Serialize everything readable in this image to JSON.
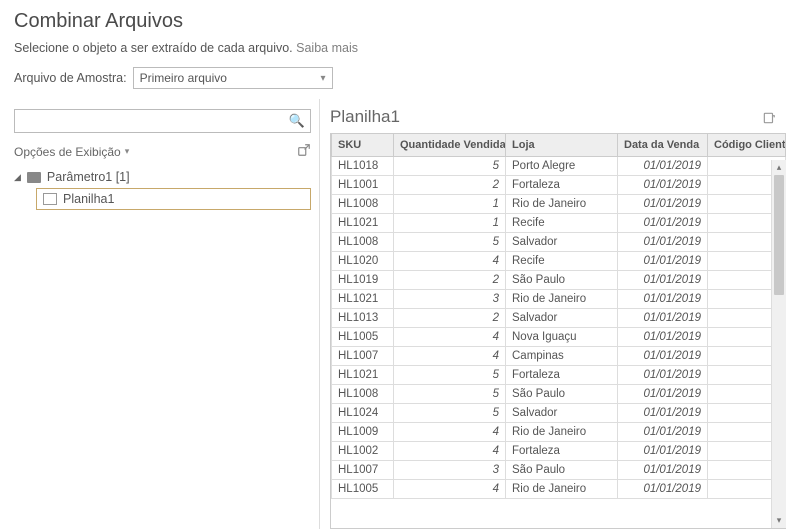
{
  "header": {
    "title": "Combinar Arquivos",
    "subtitle_text": "Selecione o objeto a ser extraído de cada arquivo. ",
    "subtitle_link": "Saiba mais"
  },
  "sample": {
    "label": "Arquivo de Amostra:",
    "selected": "Primeiro arquivo"
  },
  "left_panel": {
    "search_placeholder": "",
    "display_options": "Opções de Exibição",
    "parent_label": "Parâmetro1 [1]",
    "child_label": "Planilha1"
  },
  "preview": {
    "title": "Planilha1",
    "columns": [
      "SKU",
      "Quantidade Vendida",
      "Loja",
      "Data da Venda",
      "Código Cliente"
    ],
    "rows": [
      {
        "sku": "HL1018",
        "qty": "5",
        "loja": "Porto Alegre",
        "data": "01/01/2019",
        "cli": ""
      },
      {
        "sku": "HL1001",
        "qty": "2",
        "loja": "Fortaleza",
        "data": "01/01/2019",
        "cli": ""
      },
      {
        "sku": "HL1008",
        "qty": "1",
        "loja": "Rio de Janeiro",
        "data": "01/01/2019",
        "cli": ""
      },
      {
        "sku": "HL1021",
        "qty": "1",
        "loja": "Recife",
        "data": "01/01/2019",
        "cli": ""
      },
      {
        "sku": "HL1008",
        "qty": "5",
        "loja": "Salvador",
        "data": "01/01/2019",
        "cli": ""
      },
      {
        "sku": "HL1020",
        "qty": "4",
        "loja": "Recife",
        "data": "01/01/2019",
        "cli": ""
      },
      {
        "sku": "HL1019",
        "qty": "2",
        "loja": "São Paulo",
        "data": "01/01/2019",
        "cli": ""
      },
      {
        "sku": "HL1021",
        "qty": "3",
        "loja": "Rio de Janeiro",
        "data": "01/01/2019",
        "cli": ""
      },
      {
        "sku": "HL1013",
        "qty": "2",
        "loja": "Salvador",
        "data": "01/01/2019",
        "cli": ""
      },
      {
        "sku": "HL1005",
        "qty": "4",
        "loja": "Nova Iguaçu",
        "data": "01/01/2019",
        "cli": ""
      },
      {
        "sku": "HL1007",
        "qty": "4",
        "loja": "Campinas",
        "data": "01/01/2019",
        "cli": ""
      },
      {
        "sku": "HL1021",
        "qty": "5",
        "loja": "Fortaleza",
        "data": "01/01/2019",
        "cli": ""
      },
      {
        "sku": "HL1008",
        "qty": "5",
        "loja": "São Paulo",
        "data": "01/01/2019",
        "cli": ""
      },
      {
        "sku": "HL1024",
        "qty": "5",
        "loja": "Salvador",
        "data": "01/01/2019",
        "cli": ""
      },
      {
        "sku": "HL1009",
        "qty": "4",
        "loja": "Rio de Janeiro",
        "data": "01/01/2019",
        "cli": ""
      },
      {
        "sku": "HL1002",
        "qty": "4",
        "loja": "Fortaleza",
        "data": "01/01/2019",
        "cli": ""
      },
      {
        "sku": "HL1007",
        "qty": "3",
        "loja": "São Paulo",
        "data": "01/01/2019",
        "cli": ""
      },
      {
        "sku": "HL1005",
        "qty": "4",
        "loja": "Rio de Janeiro",
        "data": "01/01/2019",
        "cli": ""
      }
    ]
  }
}
